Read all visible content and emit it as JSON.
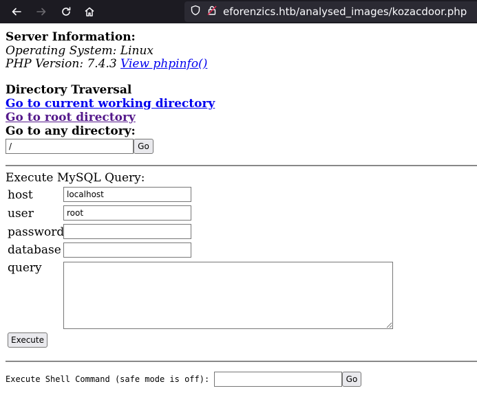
{
  "browser": {
    "url": "eforenzics.htb/analysed_images/kozacdoor.php",
    "icons": {
      "back": "back-arrow-icon",
      "forward": "forward-arrow-icon",
      "reload": "reload-icon",
      "home": "home-icon",
      "shield": "shield-icon",
      "lock": "lock-insecure-icon"
    }
  },
  "server": {
    "heading": "Server Information:",
    "os_line": "Operating System: Linux",
    "php_line": "PHP Version: 7.4.3",
    "phpinfo_link": "View phpinfo()"
  },
  "traversal": {
    "heading": "Directory Traversal",
    "cwd_link": "Go to current working directory",
    "root_link": "Go to root directory",
    "any_heading": "Go to any directory:",
    "dir_value": "/",
    "go_label": "Go"
  },
  "mysql": {
    "heading": "Execute MySQL Query:",
    "host_label": "host",
    "host_value": "localhost",
    "user_label": "user",
    "user_value": "root",
    "password_label": "password",
    "password_value": "",
    "database_label": "database",
    "database_value": "",
    "query_label": "query",
    "query_value": "",
    "execute_label": "Execute"
  },
  "shell": {
    "label": "Execute Shell Command (safe mode is off):",
    "command_value": "",
    "go_label": "Go"
  }
}
